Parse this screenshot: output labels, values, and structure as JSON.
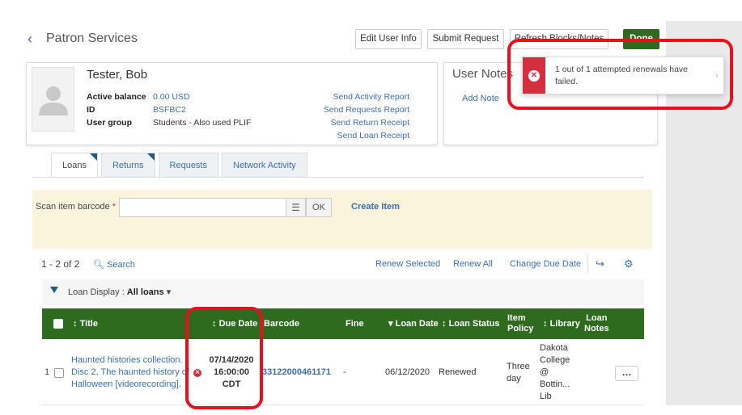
{
  "header": {
    "title": "Patron Services",
    "buttons": {
      "edit_user_info": "Edit User Info",
      "submit_request": "Submit Request",
      "refresh_blocks_notes": "Refresh Blocks/Notes",
      "done": "Done"
    }
  },
  "patron": {
    "name": "Tester, Bob",
    "fields": [
      {
        "label": "Active balance",
        "value": "0.00 USD"
      },
      {
        "label": "ID",
        "value": "BSFBC2"
      },
      {
        "label": "User group",
        "value": "Students - Also used PLIF"
      }
    ],
    "links": [
      "Send Activity Report",
      "Send Requests Report",
      "Send Return Receipt",
      "Send Loan Receipt"
    ]
  },
  "user_notes": {
    "title": "User Notes",
    "add_note": "Add Note"
  },
  "toast": {
    "message": "1 out of 1 attempted renewals have failed."
  },
  "tabs": [
    "Loans",
    "Returns",
    "Requests",
    "Network Activity"
  ],
  "scan": {
    "label": "Scan item barcode",
    "required_mark": "*",
    "ok": "OK",
    "create_item": "Create Item"
  },
  "list_toolbar": {
    "count": "1 - 2 of 2",
    "search": "Search",
    "renew_selected": "Renew Selected",
    "renew_all": "Renew All",
    "change_due_date": "Change Due Date"
  },
  "filter": {
    "label": "Loan Display :",
    "value": "All loans"
  },
  "table": {
    "columns": {
      "title": "Title",
      "due_date": "Due Date",
      "barcode": "Barcode",
      "fine": "Fine",
      "loan_date": "Loan Date",
      "loan_status": "Loan Status",
      "item_policy_1": "Item",
      "item_policy_2": "Policy",
      "library": "Library",
      "loan_notes_1": "Loan",
      "loan_notes_2": "Notes"
    },
    "rows": [
      {
        "num": "1",
        "title_1": "Haunted histories collection.",
        "title_2": "Disc 2, The haunted history of",
        "title_3": "Halloween [videorecording].",
        "due_1": "07/14/2020",
        "due_2": "16:00:00",
        "due_3": "CDT",
        "barcode": "33122000461171",
        "fine": "-",
        "loan_date": "06/12/2020",
        "loan_status": "Renewed",
        "item_policy_1": "Three",
        "item_policy_2": "day",
        "library_1": "Dakota",
        "library_2": "College",
        "library_3": "@",
        "library_4": "Bottin...",
        "library_5": "Lib",
        "more": "…"
      }
    ]
  },
  "colors": {
    "header_green": "#2e6b1f",
    "link_blue": "#3a6fb0",
    "error_red": "#d32f3f",
    "highlight_red": "#e8101e",
    "scan_panel_bg": "#fbf4dc"
  },
  "icons": [
    "chevron-left-icon",
    "avatar-placeholder-icon",
    "error-x-icon",
    "chevron-right-icon",
    "list-icon",
    "search-icon",
    "export-icon",
    "gear-icon",
    "filter-icon",
    "caret-down-icon",
    "sort-icon",
    "checkbox-icon",
    "more-icon"
  ]
}
